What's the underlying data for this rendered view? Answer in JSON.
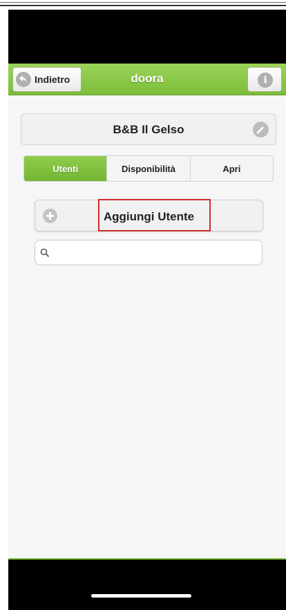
{
  "navbar": {
    "back_label": "Indietro",
    "title": "doora",
    "back_icon": "back-arrow-icon",
    "info_icon": "info-icon"
  },
  "property": {
    "name": "B&B Il Gelso",
    "edit_icon": "pencil-icon"
  },
  "tabs": [
    {
      "label": "Utenti",
      "active": true
    },
    {
      "label": "Disponibilità",
      "active": false
    },
    {
      "label": "Apri",
      "active": false
    }
  ],
  "add_user": {
    "label": "Aggiungi Utente",
    "icon": "plus-icon"
  },
  "search": {
    "placeholder": "",
    "value": "",
    "icon": "search-icon"
  },
  "colors": {
    "accent_green": "#7cbd38",
    "highlight_red": "#d42a2a"
  }
}
